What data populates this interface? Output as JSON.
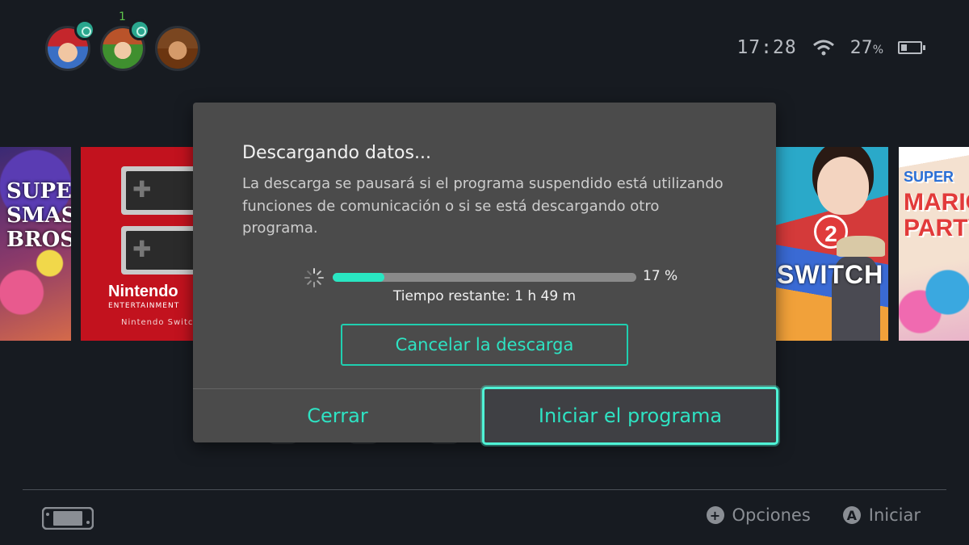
{
  "header": {
    "users": [
      {
        "name": "mario-avatar"
      },
      {
        "name": "mii-avatar",
        "notification_count": "1"
      },
      {
        "name": "donkey-kong-avatar"
      }
    ],
    "time": "17:28",
    "battery_percent": "27",
    "battery_unit": "%"
  },
  "tiles": {
    "smash_logo": "SUPER SMASH BROS",
    "nes_title": "Nintendo",
    "nes_subtitle": "ENTERTAINMENT",
    "nes_online": "Nintendo Switch",
    "twelve_switch_number": "2",
    "twelve_switch_text": "SWITCH",
    "party_super": "SUPER",
    "party_logo": "MARIO PARTY"
  },
  "dialog": {
    "title": "Descargando datos...",
    "body": "La descarga se pausará si el programa suspendido está utilizando funciones de comunicación o si se está descargando otro programa.",
    "progress_fraction": 0.17,
    "progress_label": "17 %",
    "time_remaining": "Tiempo restante: 1 h 49 m",
    "cancel_label": "Cancelar la descarga",
    "close_label": "Cerrar",
    "start_label": "Iniciar el programa"
  },
  "footer": {
    "options_button": "+",
    "options_label": "Opciones",
    "start_button": "A",
    "start_label": "Iniciar"
  },
  "colors": {
    "background": "#171b21",
    "accent": "#2ee3c3",
    "dialog": "#4b4b4b"
  }
}
